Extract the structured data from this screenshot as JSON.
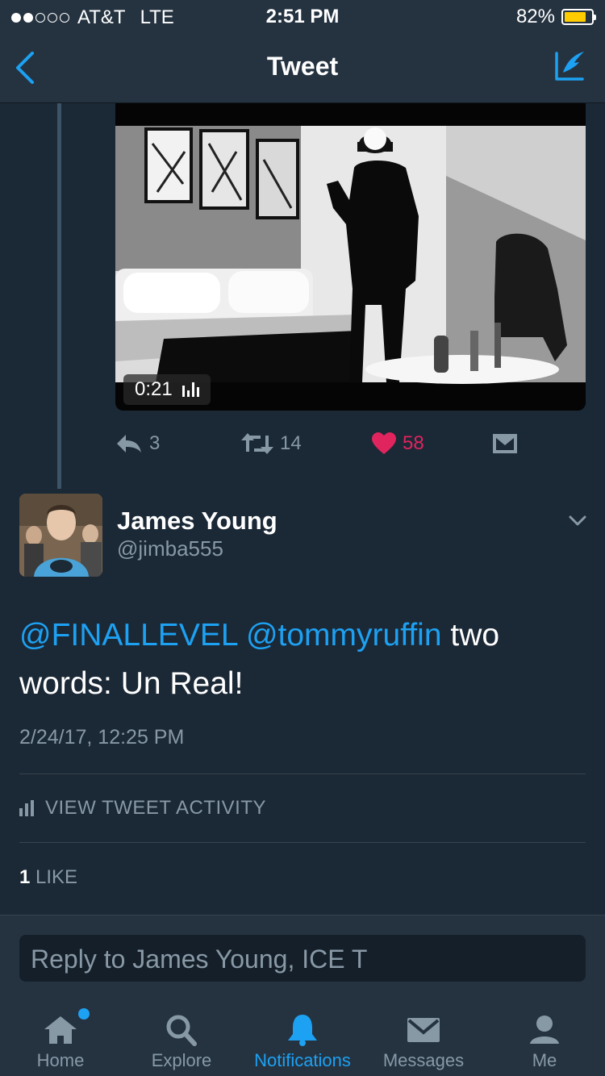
{
  "status_bar": {
    "carrier": "AT&T",
    "network": "LTE",
    "time": "2:51 PM",
    "battery_percent": "82%",
    "battery_level": 0.82,
    "signal_bars_filled": 2,
    "signal_bars_total": 5
  },
  "nav": {
    "title": "Tweet",
    "back_icon": "chevron-left-icon",
    "compose_icon": "compose-tweet-icon"
  },
  "parent_tweet": {
    "video": {
      "duration": "0:21"
    },
    "actions": {
      "replies": "3",
      "retweets": "14",
      "likes": "58"
    }
  },
  "tweet": {
    "author_name": "James Young",
    "author_handle": "@jimba555",
    "mention_1": "@FINALLEVEL",
    "mention_2": "@tommyruffin",
    "text": "two words: Un Real!",
    "timestamp": "2/24/17, 12:25 PM",
    "activity_label": "VIEW TWEET ACTIVITY",
    "likes_count": "1",
    "likes_label": "LIKE"
  },
  "reply": {
    "placeholder": "Reply to James Young, ICE T"
  },
  "tabs": [
    {
      "label": "Home",
      "icon": "home-icon"
    },
    {
      "label": "Explore",
      "icon": "search-icon"
    },
    {
      "label": "Notifications",
      "icon": "bell-icon"
    },
    {
      "label": "Messages",
      "icon": "envelope-icon"
    },
    {
      "label": "Me",
      "icon": "person-icon"
    }
  ],
  "colors": {
    "background": "#1b2836",
    "bar": "#253341",
    "accent": "#1da1f2",
    "like": "#e0245e",
    "muted": "#8899a6"
  }
}
